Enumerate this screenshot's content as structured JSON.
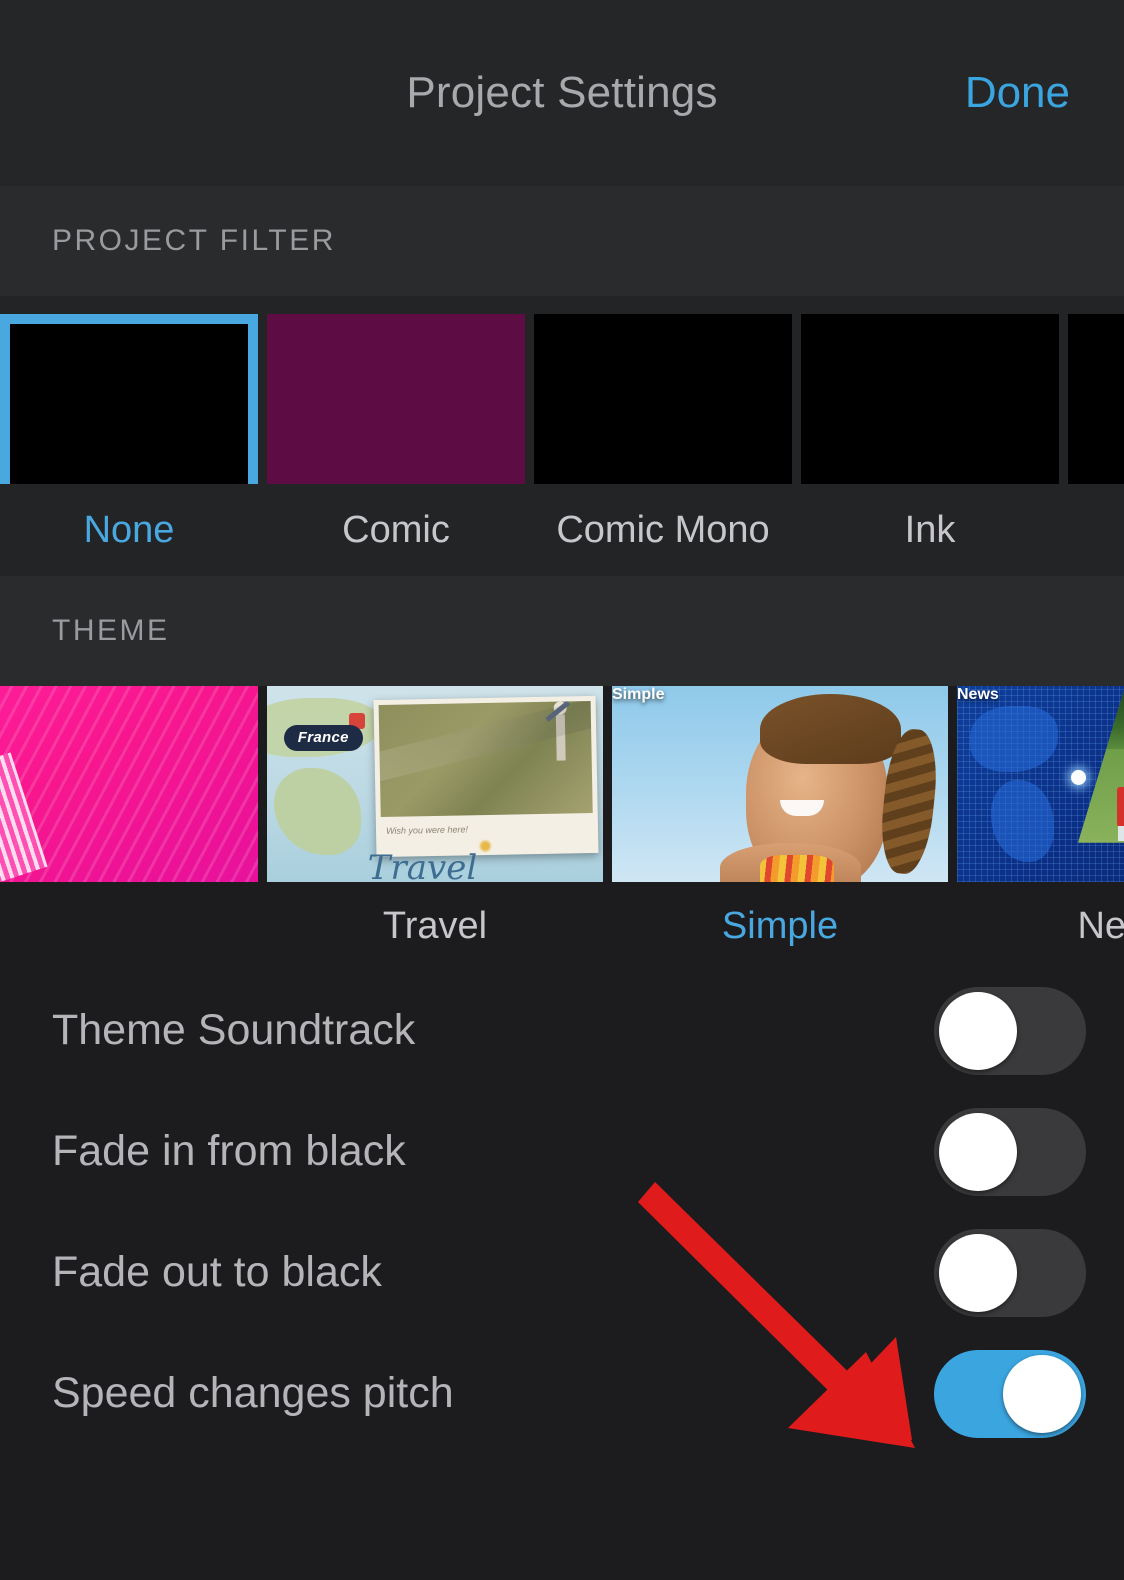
{
  "header": {
    "title": "Project Settings",
    "done_label": "Done"
  },
  "sections": {
    "filter": {
      "label": "PROJECT FILTER"
    },
    "theme": {
      "label": "THEME"
    }
  },
  "filters": [
    {
      "label": "None",
      "selected": true,
      "swatch": "#000000"
    },
    {
      "label": "Comic",
      "selected": false,
      "swatch": "#5d0c44"
    },
    {
      "label": "Comic Mono",
      "selected": false,
      "swatch": "#000000"
    },
    {
      "label": "Ink",
      "selected": false,
      "swatch": "#000000"
    },
    {
      "label": "",
      "selected": false,
      "swatch": "#000000"
    }
  ],
  "themes": [
    {
      "label": "",
      "caption": "",
      "selected": false
    },
    {
      "label": "Travel",
      "caption": "Travel",
      "selected": false
    },
    {
      "label": "Simple",
      "caption": "Simple",
      "selected": true
    },
    {
      "label": "News",
      "caption": "News",
      "selected": false
    }
  ],
  "theme_art": {
    "travel_tag": "France",
    "travel_postcard_text": "Wish you were here!",
    "travel_script": "Travel"
  },
  "settings_rows": [
    {
      "label": "Theme Soundtrack",
      "on": false
    },
    {
      "label": "Fade in from black",
      "on": false
    },
    {
      "label": "Fade out to black",
      "on": false
    },
    {
      "label": "Speed changes pitch",
      "on": true
    }
  ],
  "annotation": {
    "type": "arrow",
    "color": "#e01b1b",
    "points_to": "Speed changes pitch toggle"
  },
  "colors": {
    "accent_blue": "#3ba5e0",
    "selection_blue": "#4aa8e0",
    "background": "#1c1c1e",
    "section_header_bg": "#2a2b2d",
    "navbar_bg": "#252628",
    "toggle_off": "#3a3a3c",
    "annotation_red": "#e01b1b"
  }
}
